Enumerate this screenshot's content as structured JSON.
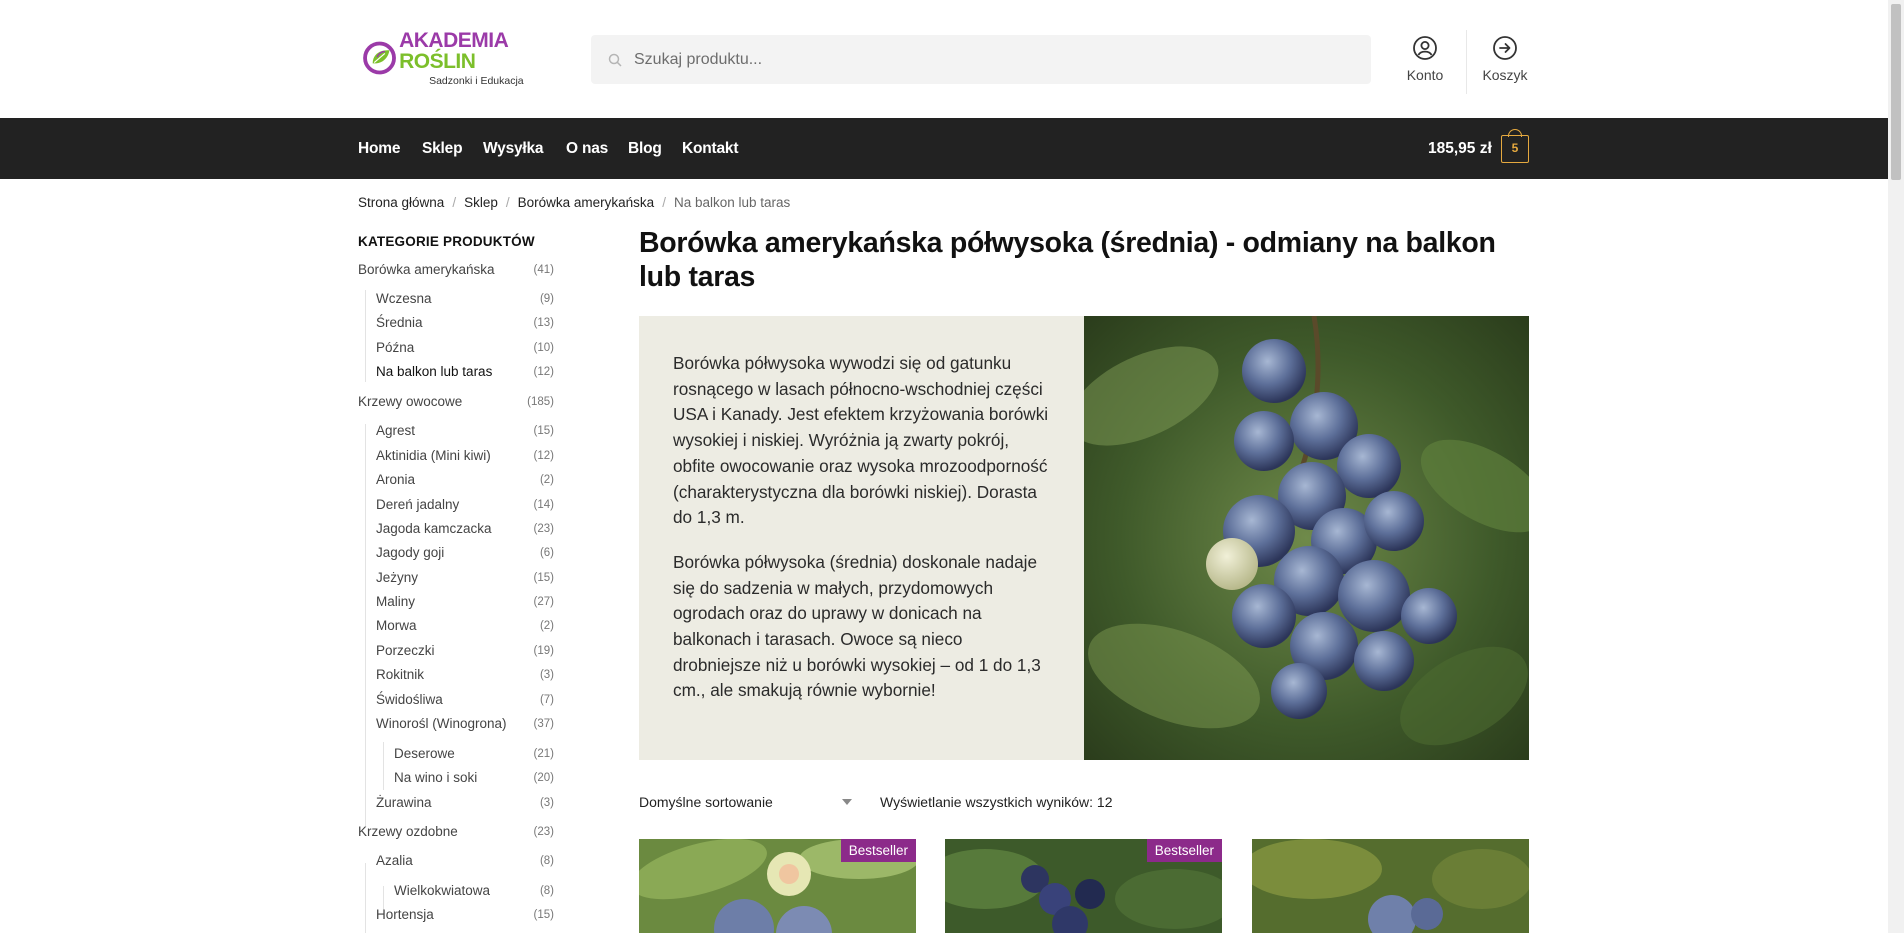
{
  "header": {
    "logo_word1": "AKADEMIA",
    "logo_word2": "ROŚLIN",
    "logo_sub": "Sadzonki i Edukacja",
    "search_placeholder": "Szukaj produktu...",
    "account_label": "Konto",
    "cart_label": "Koszyk"
  },
  "nav": {
    "items": [
      "Home",
      "Sklep",
      "Wysyłka",
      "O nas",
      "Blog",
      "Kontakt"
    ],
    "cart_total": "185,95 zł",
    "cart_count": "5"
  },
  "breadcrumb": [
    "Strona główna",
    "Sklep",
    "Borówka amerykańska",
    "Na balkon lub taras"
  ],
  "sidebar": {
    "title": "KATEGORIE PRODUKTÓW",
    "categories": [
      {
        "label": "Borówka amerykańska",
        "count": "(41)"
      },
      {
        "label": "Wczesna",
        "count": "(9)"
      },
      {
        "label": "Średnia",
        "count": "(13)"
      },
      {
        "label": "Późna",
        "count": "(10)"
      },
      {
        "label": "Na balkon lub taras",
        "count": "(12)"
      },
      {
        "label": "Krzewy owocowe",
        "count": "(185)"
      },
      {
        "label": "Agrest",
        "count": "(15)"
      },
      {
        "label": "Aktinidia (Mini kiwi)",
        "count": "(12)"
      },
      {
        "label": "Aronia",
        "count": "(2)"
      },
      {
        "label": "Dereń jadalny",
        "count": "(14)"
      },
      {
        "label": "Jagoda kamczacka",
        "count": "(23)"
      },
      {
        "label": "Jagody goji",
        "count": "(6)"
      },
      {
        "label": "Jeżyny",
        "count": "(15)"
      },
      {
        "label": "Maliny",
        "count": "(27)"
      },
      {
        "label": "Morwa",
        "count": "(2)"
      },
      {
        "label": "Porzeczki",
        "count": "(19)"
      },
      {
        "label": "Rokitnik",
        "count": "(3)"
      },
      {
        "label": "Świdośliwa",
        "count": "(7)"
      },
      {
        "label": "Winorośl (Winogrona)",
        "count": "(37)"
      },
      {
        "label": "Deserowe",
        "count": "(21)"
      },
      {
        "label": "Na wino i soki",
        "count": "(20)"
      },
      {
        "label": "Żurawina",
        "count": "(3)"
      },
      {
        "label": "Krzewy ozdobne",
        "count": "(23)"
      },
      {
        "label": "Azalia",
        "count": "(8)"
      },
      {
        "label": "Wielkokwiatowa",
        "count": "(8)"
      },
      {
        "label": "Hortensja",
        "count": "(15)"
      }
    ]
  },
  "main": {
    "title": "Borówka amerykańska półwysoka (średnia) - odmiany na balkon lub taras",
    "paragraph1": "Borówka półwysoka wywodzi się od gatunku rosnącego w lasach północno-wschodniej części USA i Kanady. Jest efektem krzyżowania borówki wysokiej i niskiej. Wyróżnia ją zwarty pokrój, obfite owocowanie oraz wysoka mrozoodporność (charakterystyczna dla borówki niskiej). Dorasta do 1,3 m.",
    "paragraph2": "Borówka półwysoka (średnia) doskonale nadaje się do sadzenia w małych, przydomowych ogrodach oraz do uprawy w donicach na balkonach i tarasach. Owoce są nieco drobniejsze niż u borówki wysokiej – od 1 do 1,3 cm., ale smakują równie wybornie!",
    "sort_label": "Domyślne sortowanie",
    "results_text": "Wyświetlanie wszystkich wyników: 12",
    "badge_label": "Bestseller"
  },
  "colors": {
    "nav_bg": "#222222",
    "accent_orange": "#e5a93f",
    "badge_purple": "#8c2a8a",
    "desc_bg": "#edece3"
  }
}
